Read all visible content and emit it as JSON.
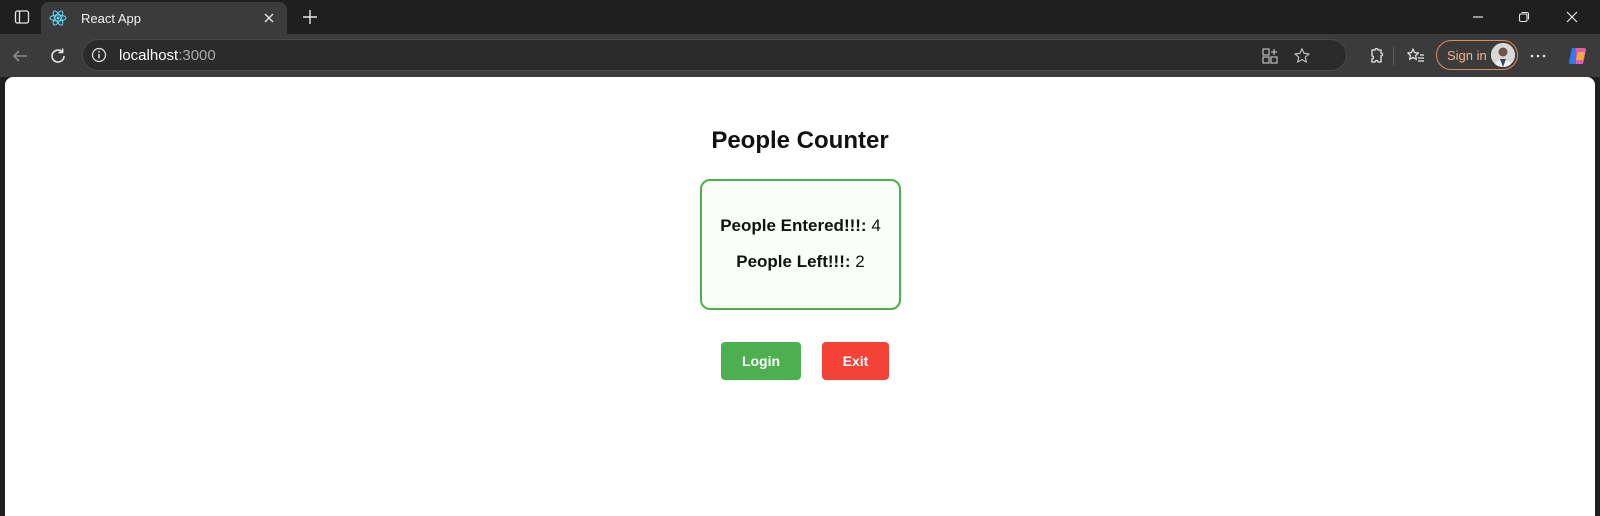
{
  "browser": {
    "tab": {
      "title": "React App",
      "favicon": "react-logo-icon"
    },
    "address": {
      "host": "localhost",
      "port": ":3000"
    },
    "signin_label": "Sign in"
  },
  "page": {
    "title": "People Counter",
    "entered": {
      "label": "People Entered!!!:",
      "value": "4"
    },
    "left": {
      "label": "People Left!!!:",
      "value": "2"
    },
    "buttons": {
      "login": "Login",
      "exit": "Exit"
    }
  },
  "colors": {
    "login": "#4caf50",
    "exit": "#f44336",
    "box_border": "#4caf50"
  }
}
